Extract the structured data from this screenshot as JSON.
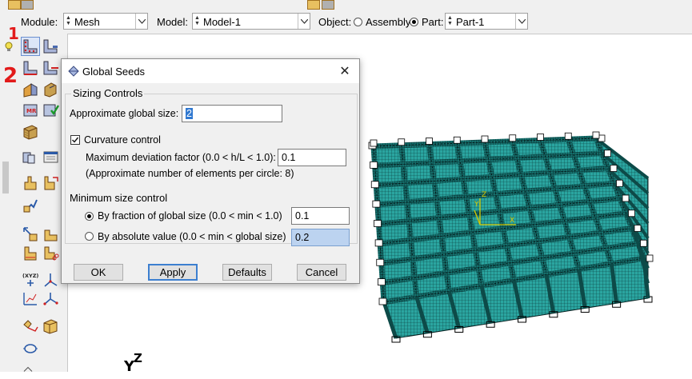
{
  "context_bar": {
    "module_label": "Module:",
    "module_value": "Mesh",
    "model_label": "Model:",
    "model_value": "Model-1",
    "object_label": "Object:",
    "assembly_label": "Assembly",
    "part_label": "Part:",
    "part_value": "Part-1",
    "object_selected": "Part"
  },
  "annotations": {
    "step1": "1",
    "step2": "2"
  },
  "dialog": {
    "title": "Global Seeds",
    "sizing_group": "Sizing Controls",
    "approx_size_label": "Approximate global size:",
    "approx_size_value": "2",
    "curvature_label": "Curvature control",
    "curvature_checked": true,
    "max_dev_label": "Maximum deviation factor (0.0 < h/L < 1.0):",
    "max_dev_value": "0.1",
    "approx_elements_note": "(Approximate number of elements per circle: 8)",
    "min_size_group": "Minimum size control",
    "by_fraction_label": "By fraction of global size   (0.0 < min < 1.0)",
    "by_fraction_value": "0.1",
    "by_absolute_label": "By absolute value  (0.0 < min < global size)",
    "by_absolute_value": "0.2",
    "min_size_selected": "fraction",
    "buttons": {
      "ok": "OK",
      "apply": "Apply",
      "defaults": "Defaults",
      "cancel": "Cancel"
    }
  },
  "viewport": {
    "triad_labels": {
      "y": "Y",
      "z": "Z",
      "x": "X"
    },
    "mesh_color": "#1f8f8c",
    "triad_color": "#d8c800"
  }
}
